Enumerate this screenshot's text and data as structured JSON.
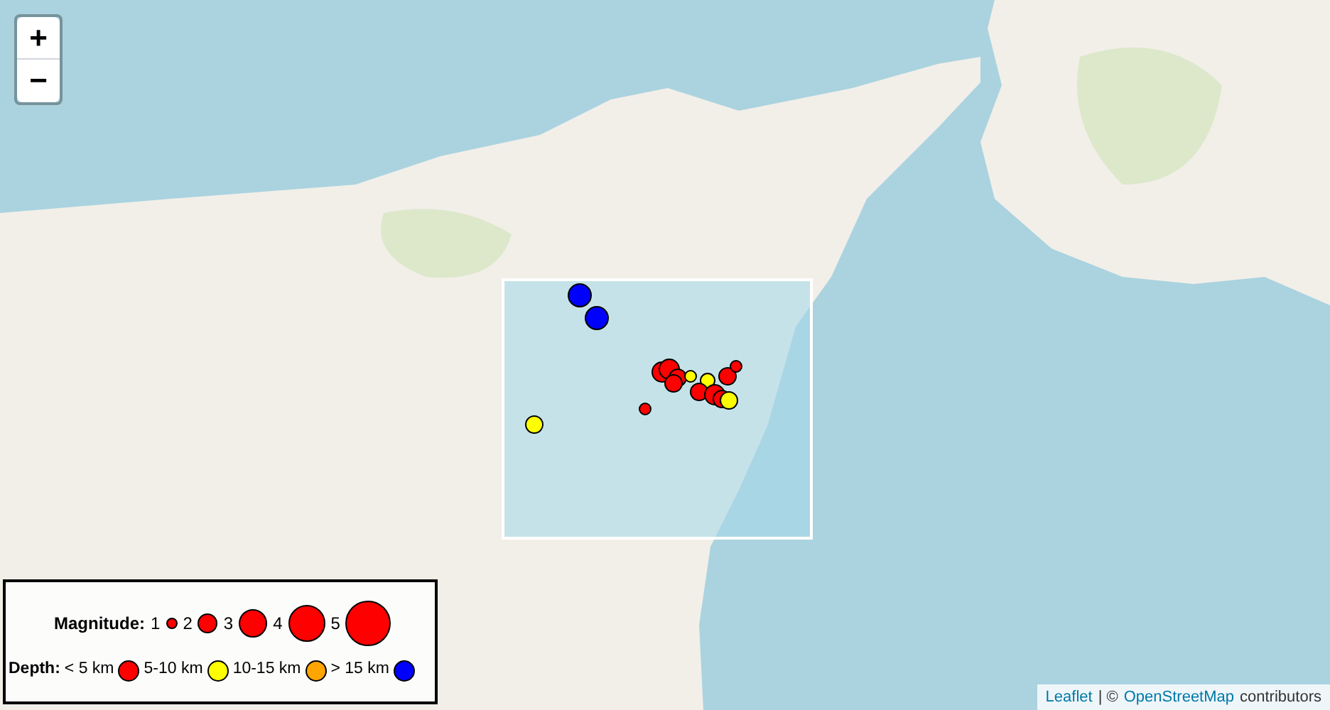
{
  "zoom_controls": [
    {
      "label": "+"
    },
    {
      "label": "−"
    }
  ],
  "legend": {
    "magnitude_title": "Magnitude:",
    "magnitudes": [
      {
        "label": "1"
      },
      {
        "label": "2"
      },
      {
        "label": "3"
      },
      {
        "label": "4"
      },
      {
        "label": "5"
      }
    ],
    "depth_title": "Depth:",
    "depths": [
      {
        "label": "< 5 km",
        "color": "#ff0000"
      },
      {
        "label": "5-10 km",
        "color": "#ffff00"
      },
      {
        "label": "10-15 km",
        "color": "#ffa500"
      },
      {
        "label": "> 15 km",
        "color": "#0000ff"
      }
    ]
  },
  "attribution": {
    "link_1": "Leaflet",
    "separator": "| ©",
    "link_2": "OpenStreetMap",
    "suffix": "contributors"
  }
}
